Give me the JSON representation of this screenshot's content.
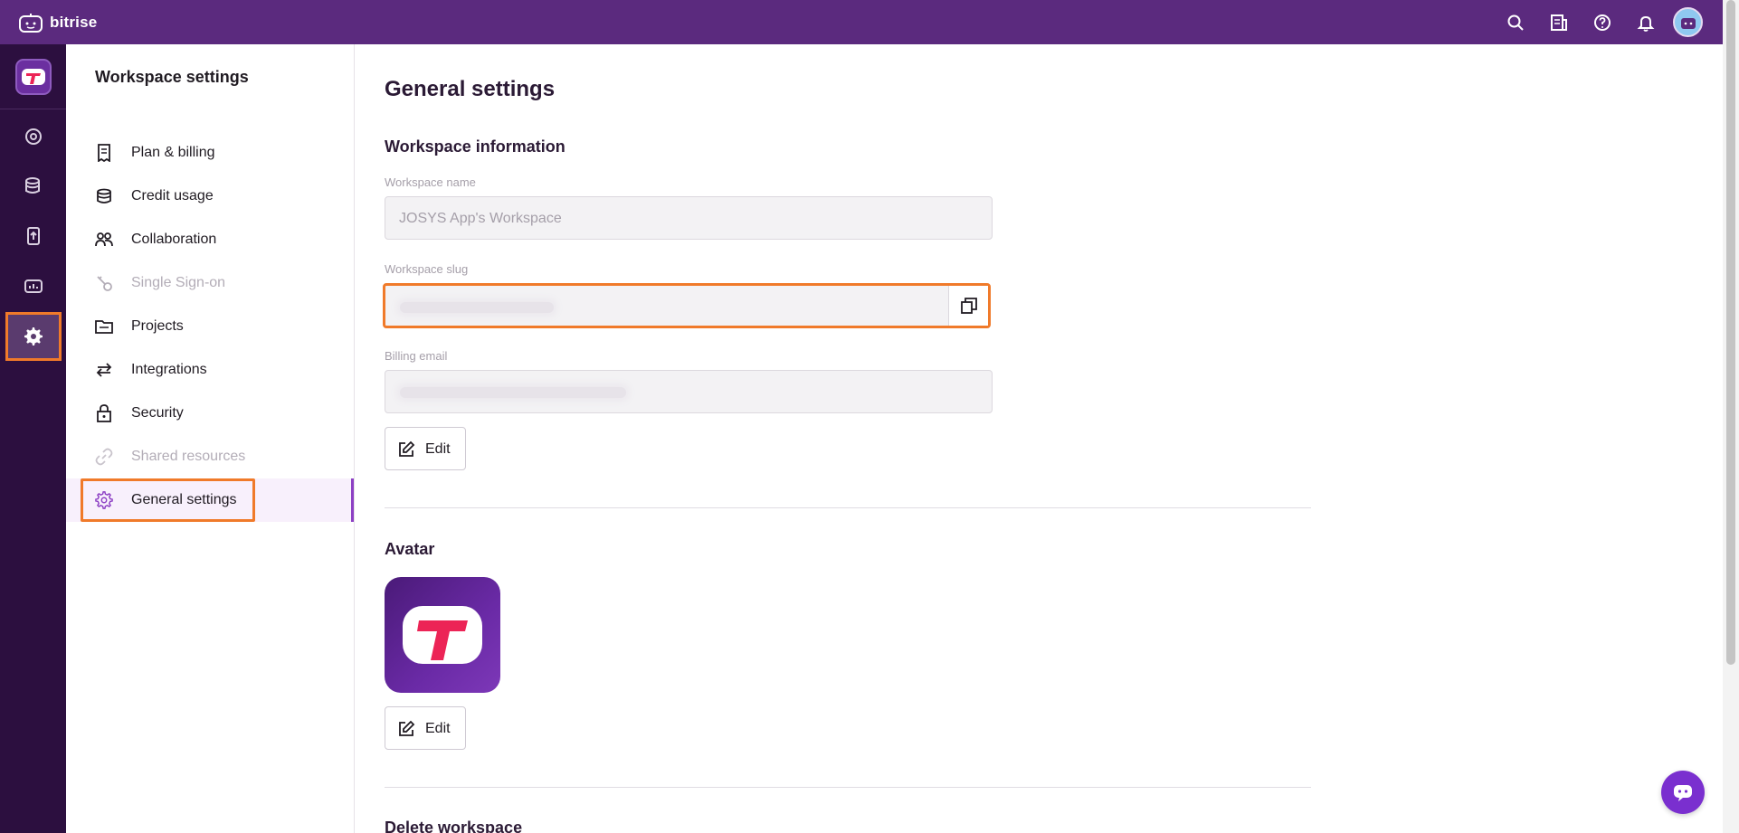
{
  "app": {
    "brand_name": "bitrise",
    "accent": "#5b2a7e",
    "highlight": "#f07a2a"
  },
  "topbar": {
    "icons": [
      "search-icon",
      "changelog-icon",
      "help-icon",
      "bell-icon",
      "user-avatar"
    ]
  },
  "rail": {
    "items": [
      "logo",
      "dashboard-icon",
      "database-icon",
      "release-icon",
      "insights-icon",
      "settings-icon"
    ],
    "active": "settings-icon"
  },
  "sidebar": {
    "title": "Workspace settings",
    "items": [
      {
        "label": "Plan & billing",
        "icon": "receipt-icon",
        "disabled": false
      },
      {
        "label": "Credit usage",
        "icon": "coins-icon",
        "disabled": false
      },
      {
        "label": "Collaboration",
        "icon": "people-icon",
        "disabled": false
      },
      {
        "label": "Single Sign-on",
        "icon": "sso-icon",
        "disabled": true
      },
      {
        "label": "Projects",
        "icon": "folder-icon",
        "disabled": false
      },
      {
        "label": "Integrations",
        "icon": "arrows-icon",
        "disabled": false
      },
      {
        "label": "Security",
        "icon": "lock-icon",
        "disabled": false
      },
      {
        "label": "Shared resources",
        "icon": "link-icon",
        "disabled": true
      },
      {
        "label": "General settings",
        "icon": "gear-icon",
        "disabled": false,
        "selected": true
      }
    ]
  },
  "main": {
    "page_title": "General settings",
    "workspace_info": {
      "title": "Workspace information",
      "name_label": "Workspace name",
      "name_value": "JOSYS App's Workspace",
      "slug_label": "Workspace slug",
      "billing_label": "Billing email",
      "edit_label": "Edit"
    },
    "avatar": {
      "title": "Avatar",
      "edit_label": "Edit"
    },
    "delete": {
      "title": "Delete workspace"
    }
  }
}
